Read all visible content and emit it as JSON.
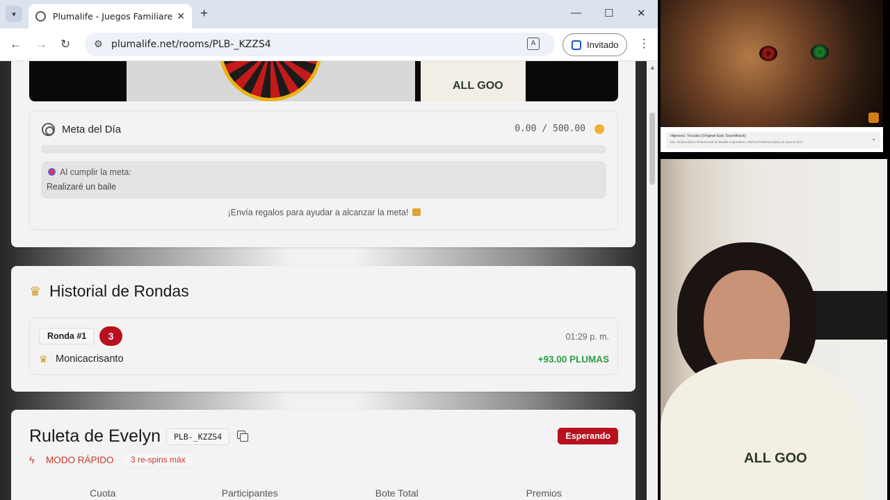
{
  "browser": {
    "tab_title": "Plumalife - Juegos Familiares a",
    "url": "plumalife.net/rooms/PLB-_KZZS4",
    "profile_label": "Invitado",
    "icons": [
      "chevron-down-icon",
      "globe-icon",
      "close-icon",
      "plus-icon",
      "minimize-icon",
      "maximize-icon",
      "close-window-icon",
      "back-icon",
      "forward-icon",
      "reload-icon",
      "tune-icon",
      "translate-icon",
      "person-icon",
      "more-vert-icon"
    ]
  },
  "video_strip": {
    "shirt_text": "ALL GOO"
  },
  "meta": {
    "label": "Meta del Día",
    "current": "0.00",
    "separator": "/",
    "goal": "500.00",
    "progress": 0,
    "reward_heading": "Al cumplir la meta:",
    "reward_text": "Realizaré un baile",
    "footer": "¡Envía regalos para ayudar a alcanzar la meta!"
  },
  "history": {
    "title": "Historial de Rondas",
    "rounds": [
      {
        "label": "Ronda #1",
        "badge": "3",
        "time": "01:29 p. m.",
        "winner": "Monicacrisanto",
        "amount": "+93.00 PLUMAS"
      }
    ]
  },
  "roulette": {
    "title": "Ruleta de Evelyn",
    "code": "PLB-_KZZS4",
    "status": "Esperando",
    "mode": "MODO RÁPIDO",
    "respins": "3 re-spins máx",
    "columns": [
      "Cuota",
      "Participantes",
      "Bote Total",
      "Premios"
    ]
  },
  "side_player": {
    "line1": "Hipnosis: Toccata (Original Epic Soundtrack)",
    "line2": "Mix: Música Épica Instrumental de Batalla Legendaria | Música Poderosa Épica de Guerra 2017"
  },
  "colors": {
    "accent_red": "#b8101d",
    "success_green": "#2a9d46",
    "trophy_gold": "#d19a1c",
    "mode_orange": "#c8372a"
  }
}
